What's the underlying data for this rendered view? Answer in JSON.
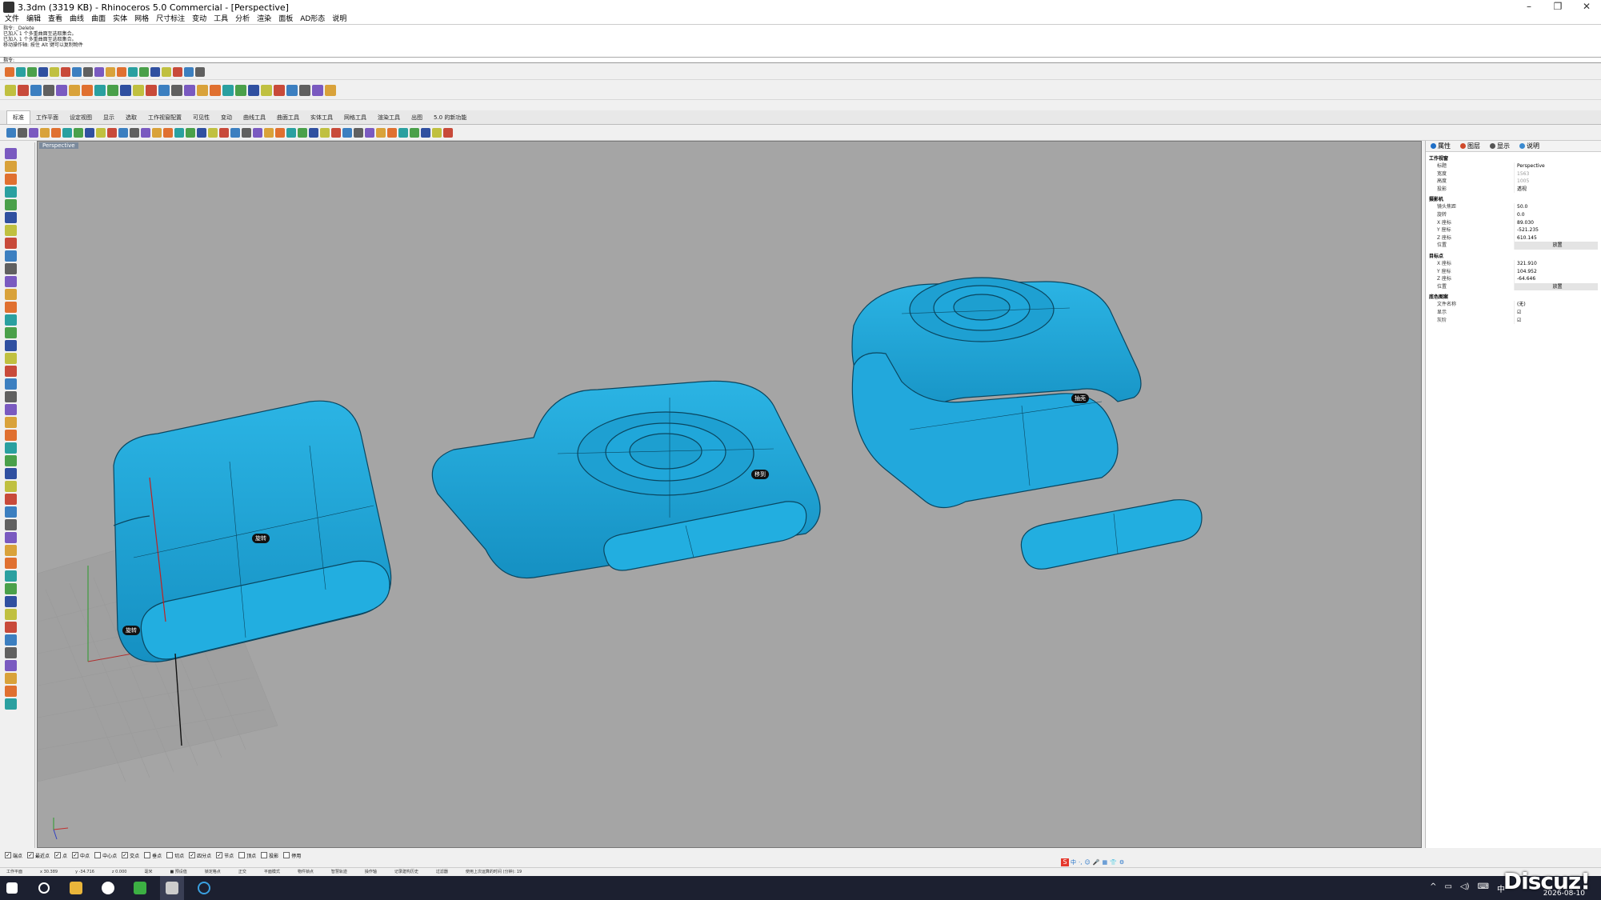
{
  "window": {
    "title": "3.3dm (3319 KB) - Rhinoceros 5.0 Commercial - [Perspective]",
    "controls": [
      "–",
      "❐",
      "✕"
    ]
  },
  "menu": [
    "文件",
    "编辑",
    "查看",
    "曲线",
    "曲面",
    "实体",
    "网格",
    "尺寸标注",
    "变动",
    "工具",
    "分析",
    "渲染",
    "面板",
    "AD形态",
    "说明"
  ],
  "command_history": [
    "指令: _Delete",
    "已加入 1 个多重曲面至选取集合。",
    "已加入 1 个多重曲面至选取集合。",
    "移动操作轴: 按住 Alt 键可以复制物件"
  ],
  "command_prompt": "指令:",
  "tabs": [
    "标准",
    "工作平面",
    "设定视图",
    "显示",
    "选取",
    "工作视窗配置",
    "可见性",
    "变动",
    "曲线工具",
    "曲面工具",
    "实体工具",
    "网格工具",
    "渲染工具",
    "出图",
    "5.0 的新功能"
  ],
  "viewport": {
    "label": "Perspective",
    "annotations": [
      "旋转",
      "旋转",
      "移到",
      "抽壳"
    ]
  },
  "right_panel": {
    "tabs": [
      "属性",
      "图层",
      "显示",
      "说明"
    ],
    "sections": [
      {
        "title": "工作视窗",
        "rows": [
          [
            "标题",
            "Perspective",
            ""
          ],
          [
            "宽度",
            "1563",
            "gray"
          ],
          [
            "高度",
            "1005",
            "gray"
          ],
          [
            "投影",
            "透视",
            ""
          ]
        ]
      },
      {
        "title": "摄影机",
        "rows": [
          [
            "镜头焦距",
            "50.0",
            ""
          ],
          [
            "旋转",
            "0.0",
            ""
          ],
          [
            "X 座标",
            "89.030",
            ""
          ],
          [
            "Y 座标",
            "-521.235",
            ""
          ],
          [
            "Z 座标",
            "610.145",
            ""
          ],
          [
            "位置",
            "放置",
            "btn"
          ]
        ]
      },
      {
        "title": "目标点",
        "rows": [
          [
            "X 座标",
            "321.910",
            ""
          ],
          [
            "Y 座标",
            "104.952",
            ""
          ],
          [
            "Z 座标",
            "-64.646",
            ""
          ],
          [
            "位置",
            "放置",
            "btn"
          ]
        ]
      },
      {
        "title": "底色图案",
        "rows": [
          [
            "文件名称",
            "(无)",
            ""
          ],
          [
            "显示",
            "☑",
            ""
          ],
          [
            "灰阶",
            "☑",
            ""
          ]
        ]
      }
    ]
  },
  "osnap": [
    [
      "端点",
      true
    ],
    [
      "最近点",
      true
    ],
    [
      "点",
      true
    ],
    [
      "中点",
      true
    ],
    [
      "中心点",
      false
    ],
    [
      "交点",
      true
    ],
    [
      "垂点",
      false
    ],
    [
      "切点",
      false
    ],
    [
      "四分点",
      true
    ],
    [
      "节点",
      true
    ],
    [
      "顶点",
      false
    ],
    [
      "投影",
      false
    ],
    [
      "停用",
      false
    ]
  ],
  "status": [
    "工作平面",
    "x 30.389",
    "y -34.716",
    "z 0.000",
    "毫米",
    "■ 预设值",
    "锁定格点",
    "正交",
    "平面模式",
    "物件锁点",
    "智慧轨迹",
    "操作轴",
    "记录建构历史",
    "过滤器",
    "使用上次运算的时间 (分钟): 19"
  ],
  "ime": [
    "中",
    "·,",
    "☺",
    "🎤",
    "▦",
    "👕",
    "⚙"
  ],
  "tray": {
    "ime": "中",
    "date": "2026-08-10"
  },
  "watermark": "Discuz!",
  "colors": {
    "viewport_bg": "#a5a5a5",
    "model": "#1ea8d8",
    "model_edge": "#0a4660"
  }
}
